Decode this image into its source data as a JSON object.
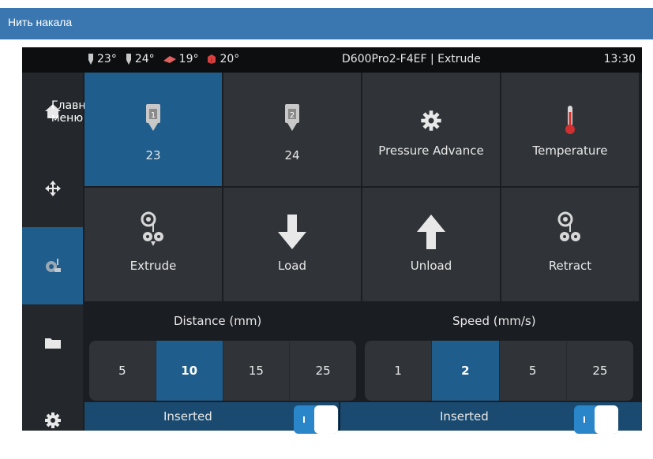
{
  "page_title": "Нить накала",
  "status": {
    "temps": [
      {
        "icon": "extruder-1-icon",
        "value": "23°"
      },
      {
        "icon": "extruder-2-icon",
        "value": "24°"
      },
      {
        "icon": "bed-icon",
        "value": "19°"
      },
      {
        "icon": "chamber-icon",
        "value": "20°"
      }
    ],
    "title": "D600Pro2-F4EF | Extrude",
    "clock": "13:30"
  },
  "sidebar": {
    "main_menu_label": "Главное меню",
    "items": [
      {
        "name": "home",
        "icon": "home-icon"
      },
      {
        "name": "move",
        "icon": "move-arrows-icon"
      },
      {
        "name": "extrude",
        "icon": "extruder-icon",
        "active": true
      },
      {
        "name": "files",
        "icon": "folder-icon"
      },
      {
        "name": "settings",
        "icon": "gear-icon"
      }
    ]
  },
  "tiles": [
    {
      "label": "23",
      "icon": "extruder-1-icon",
      "active": true
    },
    {
      "label": "24",
      "icon": "extruder-2-icon"
    },
    {
      "label": "Pressure Advance",
      "icon": "gear-icon"
    },
    {
      "label": "Temperature",
      "icon": "thermometer-icon"
    },
    {
      "label": "Extrude",
      "icon": "spool-gears-icon"
    },
    {
      "label": "Load",
      "icon": "arrow-down-icon"
    },
    {
      "label": "Unload",
      "icon": "arrow-up-icon"
    },
    {
      "label": "Retract",
      "icon": "spool-gears-icon"
    }
  ],
  "distance": {
    "label": "Distance (mm)",
    "options": [
      "5",
      "10",
      "15",
      "25"
    ],
    "selected": "10"
  },
  "speed": {
    "label": "Speed (mm/s)",
    "options": [
      "1",
      "2",
      "5",
      "25"
    ],
    "selected": "2"
  },
  "switches": [
    {
      "label": "Inserted",
      "on": true
    },
    {
      "label": "Inserted",
      "on": true
    }
  ],
  "colors": {
    "header_blue": "#3a77b0",
    "accent_blue": "#1f5d8c",
    "tile_gray": "#303438",
    "background": "#1a1d21"
  }
}
